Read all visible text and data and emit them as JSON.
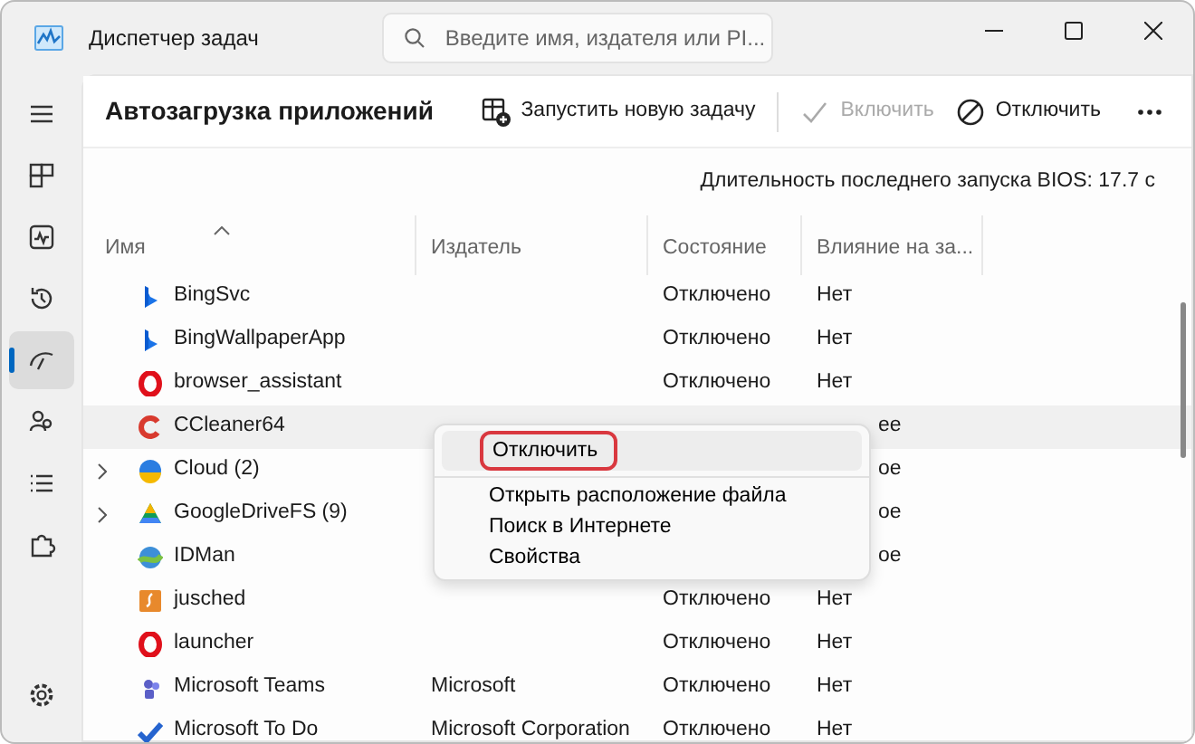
{
  "window": {
    "title": "Диспетчер задач"
  },
  "search": {
    "placeholder": "Введите имя, издателя или PI..."
  },
  "page": {
    "title": "Автозагрузка приложений"
  },
  "toolbar": [
    {
      "label": "Запустить новую задачу",
      "disabled": false
    },
    {
      "label": "Включить",
      "disabled": true
    },
    {
      "label": "Отключить",
      "disabled": false
    }
  ],
  "sidebar": {
    "items": [
      {
        "selected": false
      },
      {
        "selected": false
      },
      {
        "selected": false
      },
      {
        "selected": false
      },
      {
        "selected": true
      },
      {
        "selected": false
      },
      {
        "selected": false
      },
      {
        "selected": false
      }
    ]
  },
  "bios_time": "Длительность последнего запуска BIOS: 17.7 с",
  "table": {
    "columns": [
      "Имя",
      "Издатель",
      "Состояние",
      "Влияние на за..."
    ],
    "rows": [
      {
        "name": "BingSvc",
        "state": "Отключено",
        "impact": "Нет",
        "expandable": false,
        "hovered": false
      },
      {
        "name": "BingWallpaperApp",
        "state": "Отключено",
        "impact": "Нет",
        "expandable": false,
        "hovered": false
      },
      {
        "name": "browser_assistant",
        "state": "Отключено",
        "impact": "Нет",
        "expandable": false,
        "hovered": false
      },
      {
        "name": "CCleaner64",
        "impact": "ее",
        "expandable": false,
        "hovered": true
      },
      {
        "name": "Cloud (2)",
        "impact": "ое",
        "expandable": true,
        "hovered": false
      },
      {
        "name": "GoogleDriveFS (9)",
        "impact": "ое",
        "expandable": true,
        "hovered": false
      },
      {
        "name": "IDMan",
        "impact": "ое",
        "expandable": false,
        "hovered": false
      },
      {
        "name": "jusched",
        "state": "Отключено",
        "impact": "Нет",
        "expandable": false,
        "hovered": false
      },
      {
        "name": "launcher",
        "state": "Отключено",
        "impact": "Нет",
        "expandable": false,
        "hovered": false
      },
      {
        "name": "Microsoft Teams",
        "publisher": "Microsoft",
        "state": "Отключено",
        "impact": "Нет",
        "expandable": false,
        "hovered": false
      },
      {
        "name": "Microsoft To Do",
        "publisher": "Microsoft Corporation",
        "state": "Отключено",
        "impact": "Нет",
        "expandable": false,
        "hovered": false
      }
    ]
  },
  "context_menu": {
    "items": [
      {
        "label": "Отключить",
        "highlighted": true
      },
      {
        "label": "Открыть расположение файла",
        "highlighted": false
      },
      {
        "label": "Поиск в Интернете",
        "highlighted": false
      },
      {
        "label": "Свойства",
        "highlighted": false
      }
    ]
  }
}
